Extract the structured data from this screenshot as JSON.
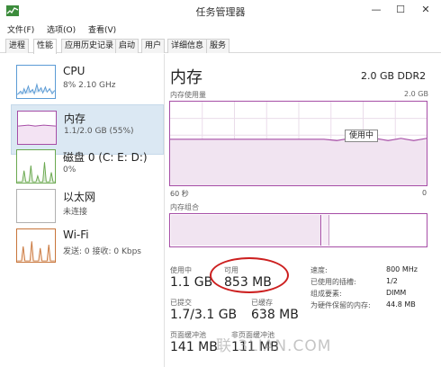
{
  "window": {
    "title": "任务管理器",
    "controls": {
      "minimize": "—",
      "maximize": "☐",
      "close": "✕"
    }
  },
  "menu": {
    "items": [
      "文件(F)",
      "选项(O)",
      "查看(V)"
    ]
  },
  "tabs": [
    "进程",
    "性能",
    "应用历史记录",
    "启动",
    "用户",
    "详细信息",
    "服务"
  ],
  "active_tab": "性能",
  "sidebar": {
    "items": [
      {
        "title": "CPU",
        "sub": "8% 2.10 GHz",
        "sub2": "",
        "color": "#5b9bd5"
      },
      {
        "title": "内存",
        "sub": "1.1/2.0 GB (55%)",
        "sub2": "",
        "color": "#a64da6",
        "selected": true
      },
      {
        "title": "磁盘 0 (C: E: D:)",
        "sub": "0%",
        "sub2": "",
        "color": "#6aa84f"
      },
      {
        "title": "以太网",
        "sub": "未连接",
        "sub2": "",
        "color": "#b0b0b0"
      },
      {
        "title": "Wi-Fi",
        "sub": "发送: 0 接收: 0 Kbps",
        "sub2": "",
        "color": "#c8753a"
      }
    ]
  },
  "main": {
    "title": "内存",
    "total": "2.0 GB DDR2",
    "usage_label": "内存使用量",
    "usage_max": "2.0 GB",
    "axis_left": "60 秒",
    "axis_right": "0",
    "composition_label": "内存组合",
    "tooltip": "使用中",
    "usage_fraction": 0.55,
    "stats": {
      "in_use_label": "使用中",
      "in_use": "1.1 GB",
      "available_label": "可用",
      "available": "853 MB",
      "committed_label": "已提交",
      "committed": "1.7/3.1 GB",
      "cached_label": "已缓存",
      "cached": "638 MB",
      "paged_pool_label": "页面缓冲池",
      "paged_pool": "141 MB",
      "nonpaged_pool_label": "非页面缓冲池",
      "nonpaged_pool": "111 MB"
    },
    "props": [
      {
        "label": "速度:",
        "value": "800 MHz"
      },
      {
        "label": "已使用的插槽:",
        "value": "1/2"
      },
      {
        "label": "组成要素:",
        "value": "DIMM"
      },
      {
        "label": "为硬件保留的内存:",
        "value": "44.8 MB"
      }
    ]
  },
  "watermark": "联 3LIAN.COM"
}
